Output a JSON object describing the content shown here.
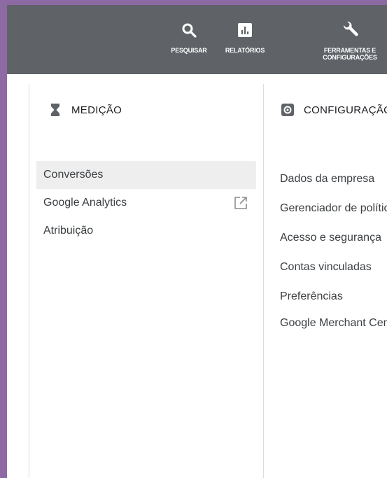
{
  "toolbar": {
    "search_label": "PESQUISAR",
    "reports_label": "RELATÓRIOS",
    "tools_label": "FERRAMENTAS E CONFIGURAÇÕES",
    "search_icon": "search-icon",
    "reports_icon": "bar-chart-icon",
    "tools_icon": "wrench-icon"
  },
  "measurement": {
    "title": "MEDIÇÃO",
    "icon": "hourglass-icon",
    "items": [
      {
        "label": "Conversões",
        "selected": true
      },
      {
        "label": "Google Analytics",
        "external": true
      },
      {
        "label": "Atribuição"
      }
    ]
  },
  "configuration": {
    "title": "CONFIGURAÇÃO",
    "icon": "settings-icon",
    "items": [
      {
        "label": "Dados da empresa"
      },
      {
        "label": "Gerenciador de políticas"
      },
      {
        "label": "Acesso e segurança"
      },
      {
        "label": "Contas vinculadas"
      },
      {
        "label": "Preferências"
      },
      {
        "label": "Google Merchant Center"
      }
    ]
  },
  "colors": {
    "page_background": "#8e6aa4",
    "toolbar_background": "#5f6368",
    "selected_background": "#eeeeee",
    "text": "#3c4043"
  }
}
